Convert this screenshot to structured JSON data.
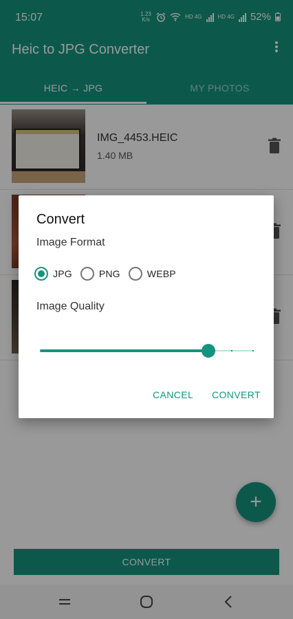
{
  "status": {
    "time": "15:07",
    "speed": "1.23 K/s",
    "net1": "HD 4G",
    "net2": "HD 4G",
    "battery": "52%"
  },
  "app": {
    "title": "Heic to JPG Converter",
    "overflow_icon": "more-vertical-icon",
    "accent_color": "#14947f"
  },
  "tabs": [
    {
      "label": "HEIC → JPG",
      "selected": true
    },
    {
      "label": "MY PHOTOS",
      "selected": false
    }
  ],
  "files": [
    {
      "name": "IMG_4453.HEIC",
      "size": "1.40 MB"
    }
  ],
  "fab": {
    "icon": "plus-icon",
    "label": "+"
  },
  "bottom": {
    "convert_label": "CONVERT"
  },
  "dialog": {
    "title": "Convert",
    "format_label": "Image Format",
    "formats": [
      {
        "label": "JPG",
        "selected": true
      },
      {
        "label": "PNG",
        "selected": false
      },
      {
        "label": "WEBP",
        "selected": false
      }
    ],
    "quality_label": "Image Quality",
    "quality_fraction": 0.79,
    "quality_steps": 10,
    "cancel_label": "CANCEL",
    "convert_label": "CONVERT"
  },
  "nav": {
    "recent_icon": "recent-apps-icon",
    "home_icon": "home-icon",
    "back_icon": "back-icon"
  }
}
